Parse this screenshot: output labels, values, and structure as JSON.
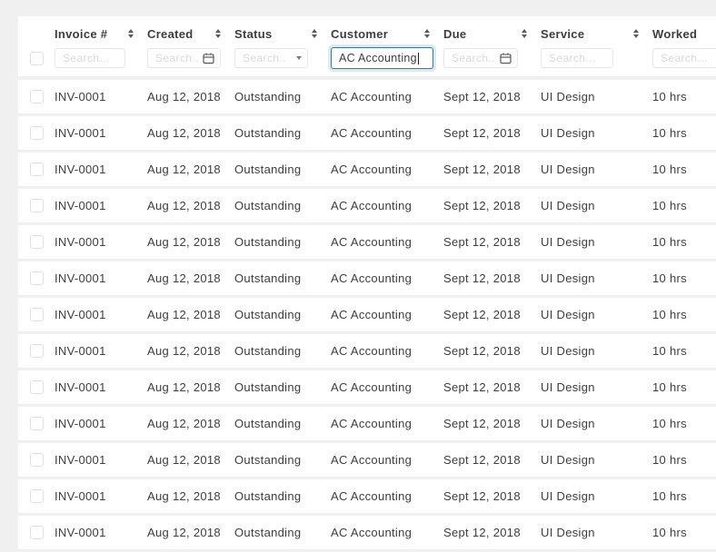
{
  "colors": {
    "page_background": "#f0f0f0",
    "card_background": "#ffffff",
    "text": "#3d3d3d",
    "input_border": "#e5e5e5",
    "placeholder_text": "#d8d8d8",
    "focused_input_border": "#48768a",
    "focused_input_glow": "#d9eaf2"
  },
  "icons": {
    "sort": "up-down-triangles",
    "calendar": "calendar-outline",
    "dropdown": "caret-down"
  },
  "columns": [
    {
      "key": "invoice",
      "label": "Invoice #",
      "filter": {
        "type": "text",
        "placeholder": "Search..."
      }
    },
    {
      "key": "created",
      "label": "Created",
      "filter": {
        "type": "date",
        "placeholder": "Search..."
      }
    },
    {
      "key": "status",
      "label": "Status",
      "filter": {
        "type": "select",
        "placeholder": "Search..."
      }
    },
    {
      "key": "customer",
      "label": "Customer",
      "filter": {
        "type": "text",
        "placeholder": "",
        "value": "AC Accounting",
        "focused": true
      }
    },
    {
      "key": "due",
      "label": "Due",
      "filter": {
        "type": "date",
        "placeholder": "Search..."
      }
    },
    {
      "key": "service",
      "label": "Service",
      "filter": {
        "type": "text",
        "placeholder": "Search..."
      }
    },
    {
      "key": "worked",
      "label": "Worked",
      "filter": {
        "type": "text",
        "placeholder": "Search..."
      }
    }
  ],
  "rows": [
    {
      "invoice": "INV-0001",
      "created": "Aug 12, 2018",
      "status": "Outstanding",
      "customer": "AC Accounting",
      "due": "Sept 12, 2018",
      "service": "UI Design",
      "worked": "10 hrs"
    },
    {
      "invoice": "INV-0001",
      "created": "Aug 12, 2018",
      "status": "Outstanding",
      "customer": "AC Accounting",
      "due": "Sept 12, 2018",
      "service": "UI Design",
      "worked": "10 hrs"
    },
    {
      "invoice": "INV-0001",
      "created": "Aug 12, 2018",
      "status": "Outstanding",
      "customer": "AC Accounting",
      "due": "Sept 12, 2018",
      "service": "UI Design",
      "worked": "10 hrs"
    },
    {
      "invoice": "INV-0001",
      "created": "Aug 12, 2018",
      "status": "Outstanding",
      "customer": "AC Accounting",
      "due": "Sept 12, 2018",
      "service": "UI Design",
      "worked": "10 hrs"
    },
    {
      "invoice": "INV-0001",
      "created": "Aug 12, 2018",
      "status": "Outstanding",
      "customer": "AC Accounting",
      "due": "Sept 12, 2018",
      "service": "UI Design",
      "worked": "10 hrs"
    },
    {
      "invoice": "INV-0001",
      "created": "Aug 12, 2018",
      "status": "Outstanding",
      "customer": "AC Accounting",
      "due": "Sept 12, 2018",
      "service": "UI Design",
      "worked": "10 hrs"
    },
    {
      "invoice": "INV-0001",
      "created": "Aug 12, 2018",
      "status": "Outstanding",
      "customer": "AC Accounting",
      "due": "Sept 12, 2018",
      "service": "UI Design",
      "worked": "10 hrs"
    },
    {
      "invoice": "INV-0001",
      "created": "Aug 12, 2018",
      "status": "Outstanding",
      "customer": "AC Accounting",
      "due": "Sept 12, 2018",
      "service": "UI Design",
      "worked": "10 hrs"
    },
    {
      "invoice": "INV-0001",
      "created": "Aug 12, 2018",
      "status": "Outstanding",
      "customer": "AC Accounting",
      "due": "Sept 12, 2018",
      "service": "UI Design",
      "worked": "10 hrs"
    },
    {
      "invoice": "INV-0001",
      "created": "Aug 12, 2018",
      "status": "Outstanding",
      "customer": "AC Accounting",
      "due": "Sept 12, 2018",
      "service": "UI Design",
      "worked": "10 hrs"
    },
    {
      "invoice": "INV-0001",
      "created": "Aug 12, 2018",
      "status": "Outstanding",
      "customer": "AC Accounting",
      "due": "Sept 12, 2018",
      "service": "UI Design",
      "worked": "10 hrs"
    },
    {
      "invoice": "INV-0001",
      "created": "Aug 12, 2018",
      "status": "Outstanding",
      "customer": "AC Accounting",
      "due": "Sept 12, 2018",
      "service": "UI Design",
      "worked": "10 hrs"
    },
    {
      "invoice": "INV-0001",
      "created": "Aug 12, 2018",
      "status": "Outstanding",
      "customer": "AC Accounting",
      "due": "Sept 12, 2018",
      "service": "UI Design",
      "worked": "10 hrs"
    }
  ]
}
